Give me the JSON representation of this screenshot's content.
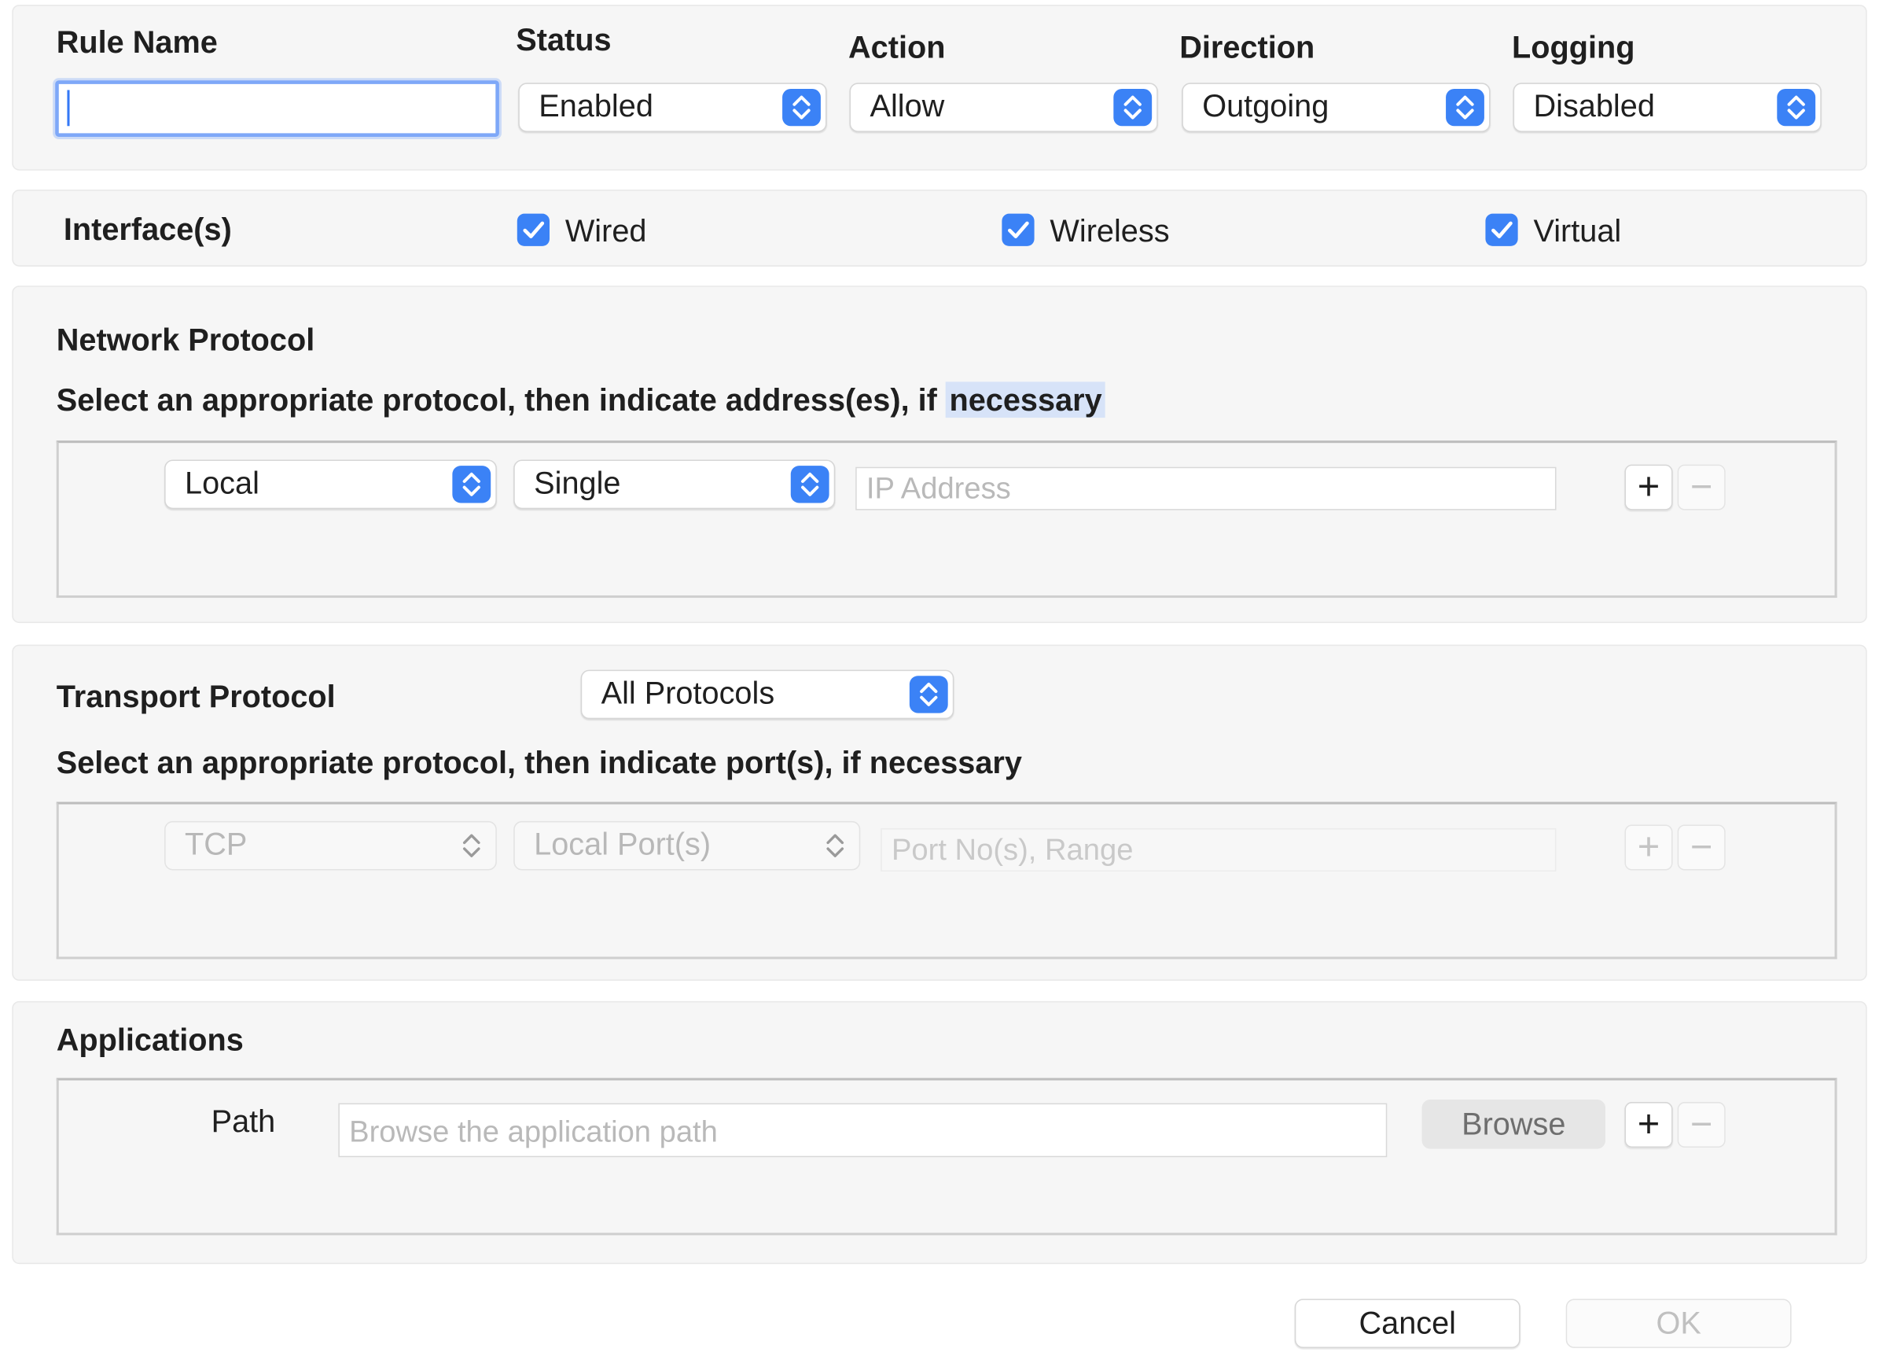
{
  "rule": {
    "name_label": "Rule Name",
    "name_value": "",
    "status_label": "Status",
    "status_value": "Enabled",
    "action_label": "Action",
    "action_value": "Allow",
    "direction_label": "Direction",
    "direction_value": "Outgoing",
    "logging_label": "Logging",
    "logging_value": "Disabled"
  },
  "interfaces": {
    "label": "Interface(s)",
    "wired": {
      "label": "Wired",
      "checked": true
    },
    "wireless": {
      "label": "Wireless",
      "checked": true
    },
    "virtual": {
      "label": "Virtual",
      "checked": true
    }
  },
  "network": {
    "title": "Network Protocol",
    "instruction_prefix": "Select an appropriate protocol, then indicate address(es), if ",
    "instruction_highlight": "necessary",
    "scope_value": "Local",
    "type_value": "Single",
    "address_placeholder": "IP Address",
    "add_label": "+",
    "remove_label": "−"
  },
  "transport": {
    "title": "Transport Protocol",
    "protocol_value": "All Protocols",
    "instruction": "Select an appropriate protocol, then indicate port(s), if necessary",
    "proto_value": "TCP",
    "port_scope_value": "Local Port(s)",
    "port_placeholder": "Port No(s), Range",
    "add_label": "+",
    "remove_label": "−"
  },
  "applications": {
    "title": "Applications",
    "path_label": "Path",
    "path_placeholder": "Browse the application path",
    "browse_label": "Browse",
    "add_label": "+",
    "remove_label": "−"
  },
  "footer": {
    "cancel_label": "Cancel",
    "ok_label": "OK"
  },
  "colors": {
    "accent": "#3b82f6",
    "focus_ring": "#7ea8f8",
    "panel_bg": "#f6f6f6",
    "highlight": "#d7e3f8"
  }
}
